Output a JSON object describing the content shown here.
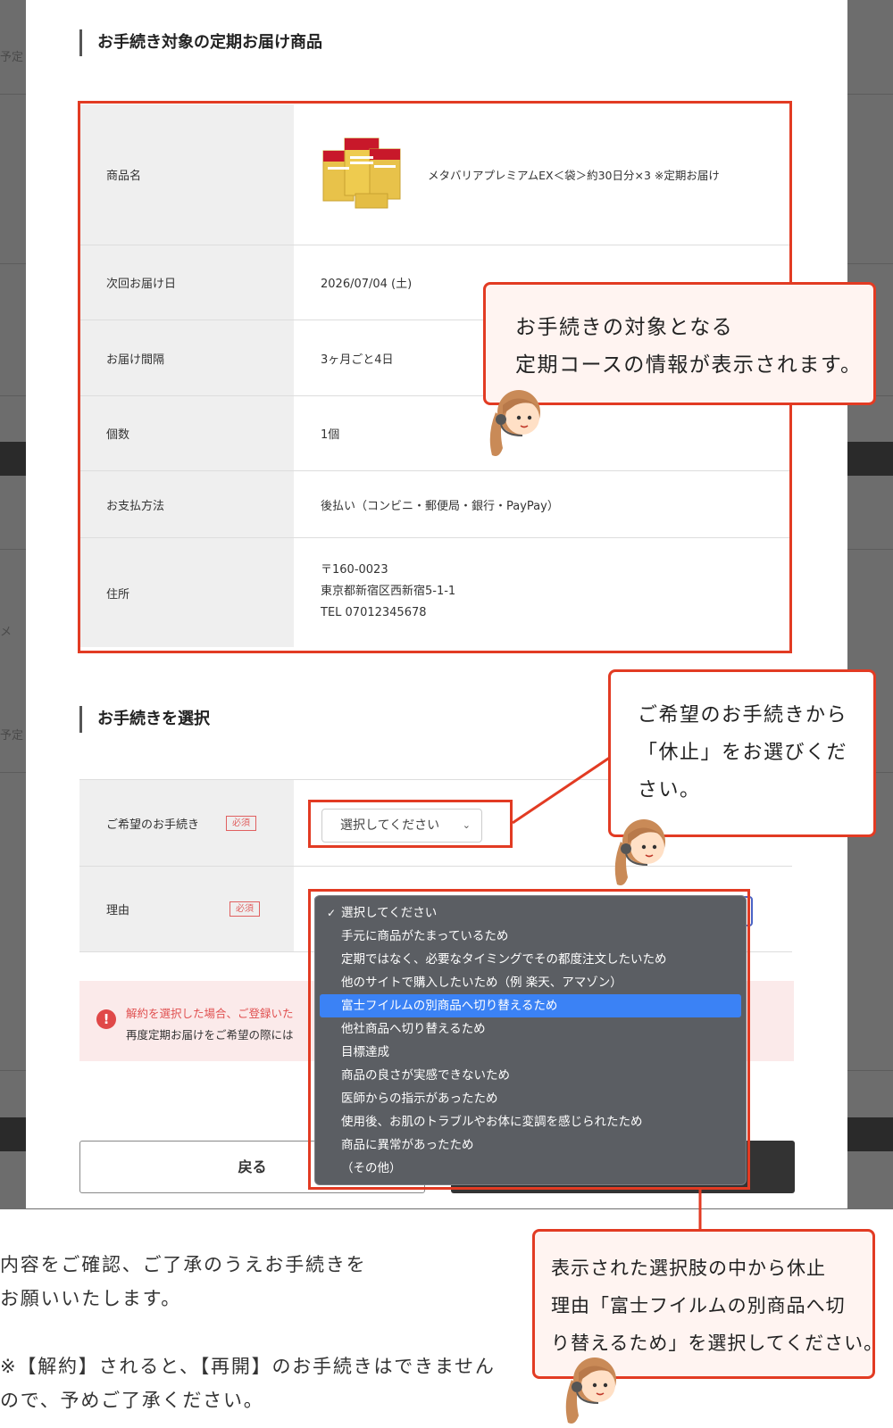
{
  "background": {
    "stub_a": "予定",
    "stub_b": "メ",
    "stub_c": "予定"
  },
  "section1": {
    "heading": "お手続き対象の定期お届け商品"
  },
  "product_table": {
    "product_label": "商品名",
    "product_name": "メタバリアプレミアムEX＜袋＞約30日分×3 ※定期お届け",
    "next_delivery_label": "次回お届け日",
    "next_delivery_value": "2026/07/04 (土)",
    "interval_label": "お届け間隔",
    "interval_value": "3ヶ月ごと4日",
    "quantity_label": "個数",
    "quantity_value": "1個",
    "payment_label": "お支払方法",
    "payment_value": "後払い（コンビニ・郵便局・銀行・PayPay）",
    "address_label": "住所",
    "address_postal": "〒160-0023",
    "address_line": "東京都新宿区西新宿5-1-1",
    "address_tel": "TEL 07012345678"
  },
  "section2": {
    "heading": "お手続きを選択"
  },
  "form": {
    "procedure_label": "ご希望のお手続き",
    "required_badge": "必須",
    "procedure_select_value": "選択してください",
    "reason_label": "理由"
  },
  "alert": {
    "line1": "解約を選択した場合、ご登録いた",
    "line2": "再度定期お届けをご希望の際には"
  },
  "buttons": {
    "back": "戻る"
  },
  "reason_menu": {
    "options": [
      "選択してください",
      "手元に商品がたまっているため",
      "定期ではなく、必要なタイミングでその都度注文したいため",
      "他のサイトで購入したいため（例 楽天、アマゾン）",
      "富士フイルムの別商品へ切り替えるため",
      "他社商品へ切り替えるため",
      "目標達成",
      "商品の良さが実感できないため",
      "医師からの指示があったため",
      "使用後、お肌のトラブルやお体に変調を感じられたため",
      "商品に異常があったため",
      "（その他）"
    ],
    "checked_index": 0,
    "highlighted_index": 4
  },
  "callouts": {
    "info": "お手続きの対象となる\n定期コースの情報が表示されます。",
    "choose": "ご希望のお手続きから\n「休止」をお選びくだ\nさい。",
    "reason": "表示された選択肢の中から休止\n理由「富士フイルムの別商品へ切\nり替えるため」を選択してください。"
  },
  "bottom_note": {
    "para1": "内容をご確認、ご了承のうえお手続きを\nお願いいたします。",
    "para2": "※【解約】されると、【再開】のお手続きはできません\nので、予めご了承ください。"
  },
  "colors": {
    "accent": "#e23b23",
    "menu_bg": "#5b5e63",
    "menu_highlight": "#3b82f5"
  }
}
